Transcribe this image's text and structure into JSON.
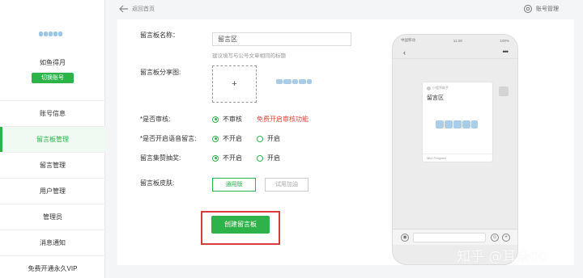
{
  "sidebar": {
    "store_name": "如鱼得月",
    "switch_label": "切换账号",
    "items": [
      {
        "label": "账号信息"
      },
      {
        "label": "留言板管理"
      },
      {
        "label": "留言管理"
      },
      {
        "label": "用户管理"
      },
      {
        "label": "管理员"
      },
      {
        "label": "消息通知"
      },
      {
        "label": "免费开通永久VIP"
      }
    ]
  },
  "header": {
    "back_label": "返回首页",
    "account_label": "账号管理"
  },
  "form": {
    "board_name_label": "留言板名称：",
    "board_name_value": "留言区",
    "board_name_hint": "建议填写与公号文章相同的标题",
    "share_image_label": "留言板分享图:",
    "upload_symbol": "+",
    "review_label": "*是否审核:",
    "review_option_no": "不审核",
    "review_link": "免费开启审核功能",
    "voice_label": "*是否开启语音留言:",
    "voice_option_off": "不开启",
    "voice_option_on": "开启",
    "lottery_label": "留言集赞抽奖:",
    "lottery_option_off": "不开启",
    "lottery_option_on": "开启",
    "skin_label": "留言板皮肤:",
    "skin_default": "通用版",
    "skin_custom": "试用加油",
    "create_button": "创建留言板"
  },
  "preview": {
    "status_carrier": "中国移动",
    "status_time": "11:28",
    "status_battery": "100%",
    "card_from": "小程序助手",
    "card_title": "留言区",
    "card_footer": "Mini Program"
  },
  "watermark": "知乎 @耳朵00",
  "colors": {
    "accent": "#2eb24a",
    "warning": "#e0463a",
    "highlight_frame": "#d93a3a"
  }
}
